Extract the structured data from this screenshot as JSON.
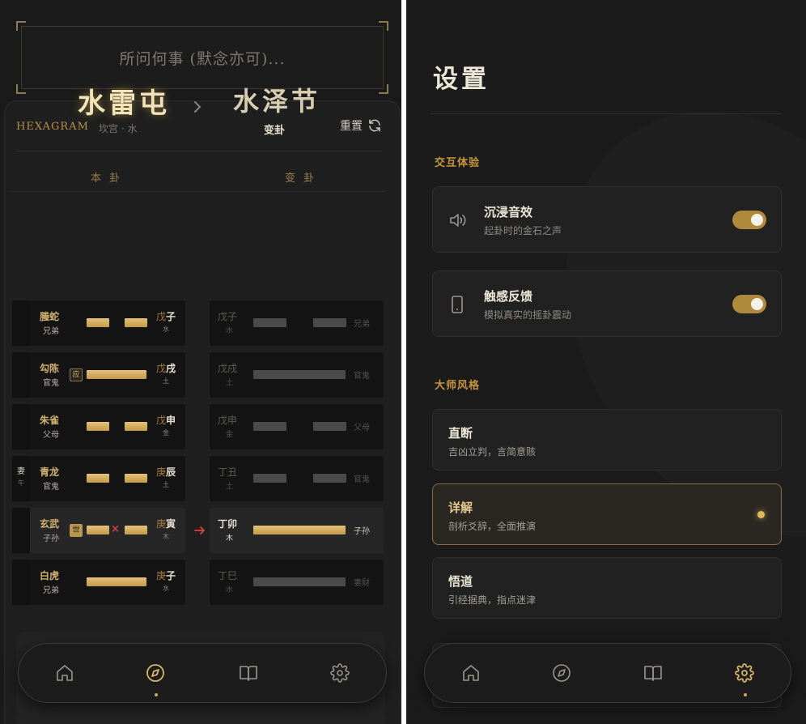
{
  "left": {
    "question_placeholder": "所问何事 (默念亦可)...",
    "hexagram_label": "HEXAGRAM",
    "reset_label": "重置",
    "main_gua": {
      "name": "水雷屯",
      "palace": "坎宫 · 水"
    },
    "changed_gua": {
      "name": "水泽节",
      "label": "变卦"
    },
    "col_ben": "本 卦",
    "col_bian": "变 卦",
    "yaos": [
      {
        "six": "",
        "six_sub": "",
        "spirit": "螣蛇",
        "relation": "兄弟",
        "tag": "",
        "naj_pre": "戊",
        "naj": "子",
        "wuxing": "水",
        "type": "yin",
        "moving": false,
        "r_naj": "戊子",
        "r_wuxing": "水",
        "r_type": "yin",
        "r_rel": "兄弟",
        "r_active": false
      },
      {
        "six": "",
        "six_sub": "",
        "spirit": "勾陈",
        "relation": "官鬼",
        "tag": "应",
        "naj_pre": "戊",
        "naj": "戌",
        "wuxing": "土",
        "type": "yang",
        "moving": false,
        "r_naj": "戊戌",
        "r_wuxing": "土",
        "r_type": "yang",
        "r_rel": "官鬼",
        "r_active": false
      },
      {
        "six": "",
        "six_sub": "",
        "spirit": "朱雀",
        "relation": "父母",
        "tag": "",
        "naj_pre": "戊",
        "naj": "申",
        "wuxing": "金",
        "type": "yin",
        "moving": false,
        "r_naj": "戊申",
        "r_wuxing": "金",
        "r_type": "yin",
        "r_rel": "父母",
        "r_active": false
      },
      {
        "six": "妻",
        "six_sub": "午",
        "spirit": "青龙",
        "relation": "官鬼",
        "tag": "",
        "naj_pre": "庚",
        "naj": "辰",
        "wuxing": "土",
        "type": "yin",
        "moving": false,
        "r_naj": "丁丑",
        "r_wuxing": "土",
        "r_type": "yin",
        "r_rel": "官鬼",
        "r_active": false
      },
      {
        "six": "",
        "six_sub": "",
        "spirit": "玄武",
        "relation": "子孙",
        "tag": "世",
        "naj_pre": "庚",
        "naj": "寅",
        "wuxing": "木",
        "type": "yin",
        "moving": true,
        "r_naj": "丁卯",
        "r_wuxing": "木",
        "r_type": "yang",
        "r_rel": "子孙",
        "r_active": true
      },
      {
        "six": "",
        "six_sub": "",
        "spirit": "白虎",
        "relation": "兄弟",
        "tag": "",
        "naj_pre": "庚",
        "naj": "子",
        "wuxing": "水",
        "type": "yang",
        "moving": false,
        "r_naj": "丁巳",
        "r_wuxing": "水",
        "r_type": "yang",
        "r_rel": "妻财",
        "r_active": false
      }
    ],
    "moving_mark": "×",
    "nav": {
      "active": "divination"
    }
  },
  "right": {
    "title": "设置",
    "section_interaction": "交互体验",
    "sound": {
      "name": "沉浸音效",
      "desc": "起卦时的金石之声",
      "enabled": true
    },
    "haptic": {
      "name": "触感反馈",
      "desc": "模拟真实的摇卦震动",
      "enabled": true
    },
    "section_style": "大师风格",
    "styles": [
      {
        "name": "直断",
        "desc": "吉凶立判，言简意赅",
        "selected": false
      },
      {
        "name": "详解",
        "desc": "剖析爻辞，全面推演",
        "selected": true
      },
      {
        "name": "悟道",
        "desc": "引经据典，指点迷津",
        "selected": false
      }
    ],
    "nav": {
      "active": "settings"
    }
  },
  "colors": {
    "accent": "#c7953f",
    "gold_bar": "#d4af5f",
    "moving": "#d94040",
    "bg": "#1a1a1a"
  },
  "icons": [
    "refresh-icon",
    "chevron-right-icon",
    "arrow-right-icon",
    "home-icon",
    "compass-icon",
    "book-icon",
    "gear-icon",
    "speaker-icon",
    "phone-icon"
  ]
}
